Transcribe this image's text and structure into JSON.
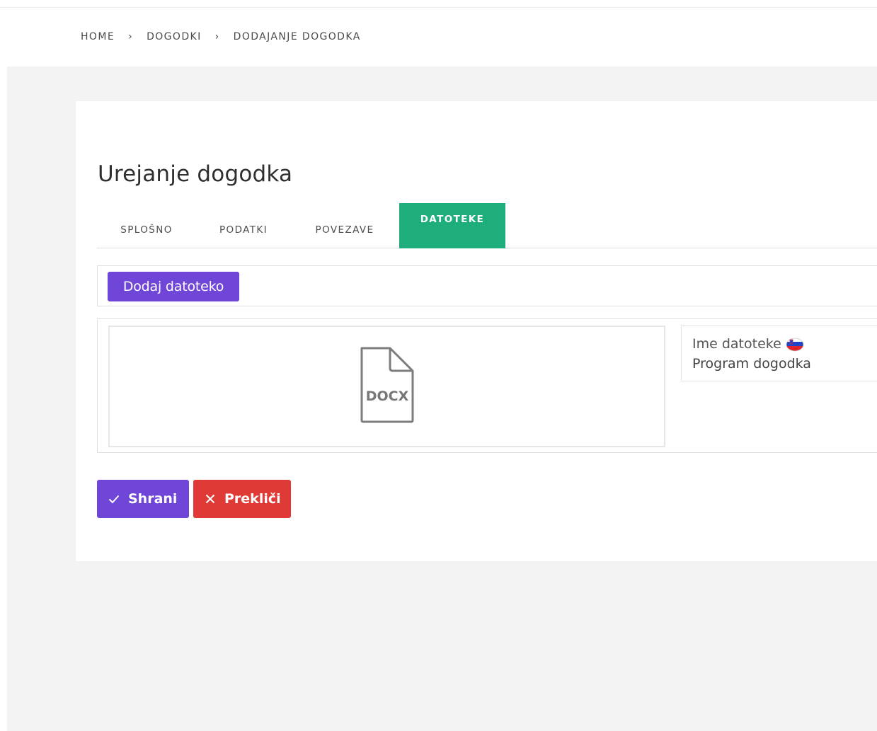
{
  "breadcrumb": {
    "items": [
      "HOME",
      "DOGODKI",
      "DODAJANJE DOGODKA"
    ],
    "separator": "›"
  },
  "page": {
    "title": "Urejanje dogodka"
  },
  "tabs": [
    {
      "label": "SPLOŠNO",
      "active": false
    },
    {
      "label": "PODATKI",
      "active": false
    },
    {
      "label": "POVEZAVE",
      "active": false
    },
    {
      "label": "DATOTEKE",
      "active": true
    }
  ],
  "toolbar": {
    "add_file_label": "Dodaj datoteko"
  },
  "file": {
    "type_label": "DOCX",
    "icon": "docx-file-icon",
    "name_label": "Ime datoteke",
    "language_flag": "slovenia-flag-icon",
    "name_value": "Program dogodka"
  },
  "actions": {
    "save_label": "Shrani",
    "cancel_label": "Prekliči"
  },
  "colors": {
    "primary": "#7046d9",
    "active_tab": "#1eae7c",
    "danger": "#df3a36",
    "page_background": "#f3f3f3"
  }
}
